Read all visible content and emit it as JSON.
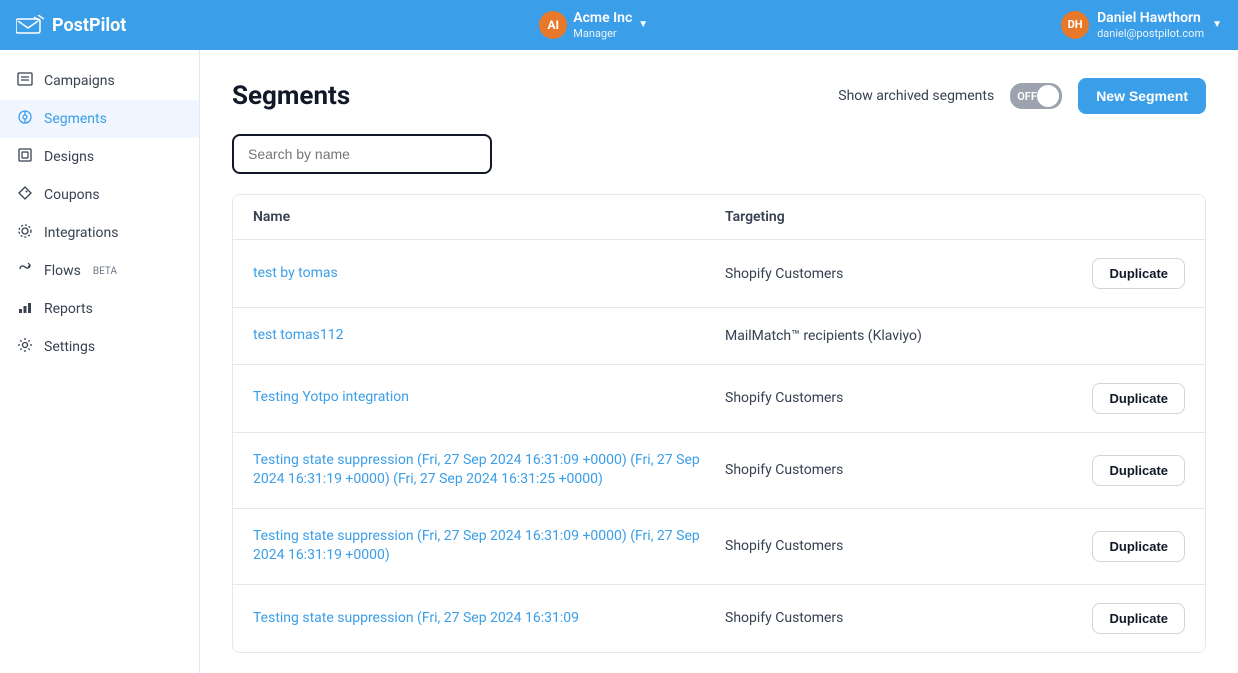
{
  "topnav": {
    "logo_text": "PostPilot",
    "company_avatar": "AI",
    "company_name": "Acme Inc",
    "company_role": "Manager",
    "user_avatar": "DH",
    "user_name": "Daniel Hawthorn",
    "user_email": "daniel@postpilot.com"
  },
  "sidebar": {
    "items": [
      {
        "id": "campaigns",
        "label": "Campaigns",
        "icon": "📋",
        "active": false
      },
      {
        "id": "segments",
        "label": "Segments",
        "icon": "◈",
        "active": true
      },
      {
        "id": "designs",
        "label": "Designs",
        "icon": "🖼",
        "active": false
      },
      {
        "id": "coupons",
        "label": "Coupons",
        "icon": "🏷",
        "active": false
      },
      {
        "id": "integrations",
        "label": "Integrations",
        "icon": "⚙",
        "active": false
      },
      {
        "id": "flows",
        "label": "Flows",
        "icon": "⟳",
        "active": false,
        "badge": "BETA"
      },
      {
        "id": "reports",
        "label": "Reports",
        "icon": "📊",
        "active": false
      },
      {
        "id": "settings",
        "label": "Settings",
        "icon": "⚙",
        "active": false
      }
    ]
  },
  "main": {
    "page_title": "Segments",
    "archived_label": "Show archived segments",
    "toggle_state": "OFF",
    "new_segment_label": "New Segment",
    "search_placeholder": "Search by name",
    "table_headers": {
      "name": "Name",
      "targeting": "Targeting"
    },
    "segments": [
      {
        "name": "test by tomas",
        "targeting": "Shopify Customers",
        "show_duplicate": true
      },
      {
        "name": "test tomas112",
        "targeting": "MailMatch™ recipients (Klaviyo)",
        "show_duplicate": false
      },
      {
        "name": "Testing Yotpo integration",
        "targeting": "Shopify Customers",
        "show_duplicate": true
      },
      {
        "name": "Testing state suppression (Fri, 27 Sep 2024 16:31:09 +0000) (Fri, 27 Sep 2024 16:31:19 +0000) (Fri, 27 Sep 2024 16:31:25 +0000)",
        "targeting": "Shopify Customers",
        "show_duplicate": true
      },
      {
        "name": "Testing state suppression (Fri, 27 Sep 2024 16:31:09 +0000) (Fri, 27 Sep 2024 16:31:19 +0000)",
        "targeting": "Shopify Customers",
        "show_duplicate": true
      },
      {
        "name": "Testing state suppression (Fri, 27 Sep 2024 16:31:09",
        "targeting": "Shopify Customers",
        "show_duplicate": true
      }
    ],
    "duplicate_label": "Duplicate"
  }
}
